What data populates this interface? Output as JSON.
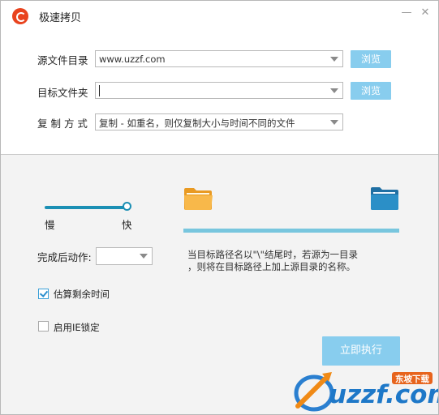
{
  "window": {
    "title": "极速拷贝",
    "minimize_glyph": "—",
    "close_glyph": "✕"
  },
  "form": {
    "source": {
      "label": "源文件目录",
      "value": "www.uzzf.com",
      "browse_label": "浏览"
    },
    "target": {
      "label": "目标文件夹",
      "value": "",
      "browse_label": "浏览"
    },
    "copy_mode": {
      "label": "复 制 方 式",
      "value": "复制 - 如重名，则仅复制大小与时间不同的文件"
    }
  },
  "speed": {
    "slow_label": "慢",
    "fast_label": "快",
    "level": 1.0
  },
  "after": {
    "label": "完成后动作:",
    "value": ""
  },
  "note": {
    "line1": "当目标路径名以\"\\\"结尾时，若源为一目录",
    "line2": "，则将在目标路径上加上源目录的名称。"
  },
  "progress": {
    "value": 1.0
  },
  "options": {
    "estimate": {
      "label": "估算剩余时间",
      "checked": true
    },
    "ie_lock": {
      "label": "启用IE锁定",
      "checked": false
    }
  },
  "execute_label": "立即执行",
  "icons": {
    "source_folder": "folder-open-icon",
    "target_folder": "folder-blue-icon",
    "app": "app-logo-icon"
  },
  "colors": {
    "accent": "#88cdee",
    "slider": "#1b8fb4",
    "progress": "#78c6de",
    "panel_bg": "#f3f3f3",
    "folder_orange": "#f6b042",
    "folder_blue": "#2b8fc7"
  },
  "watermark": {
    "brand": "uzzf.com",
    "tag": "东坡下载"
  }
}
